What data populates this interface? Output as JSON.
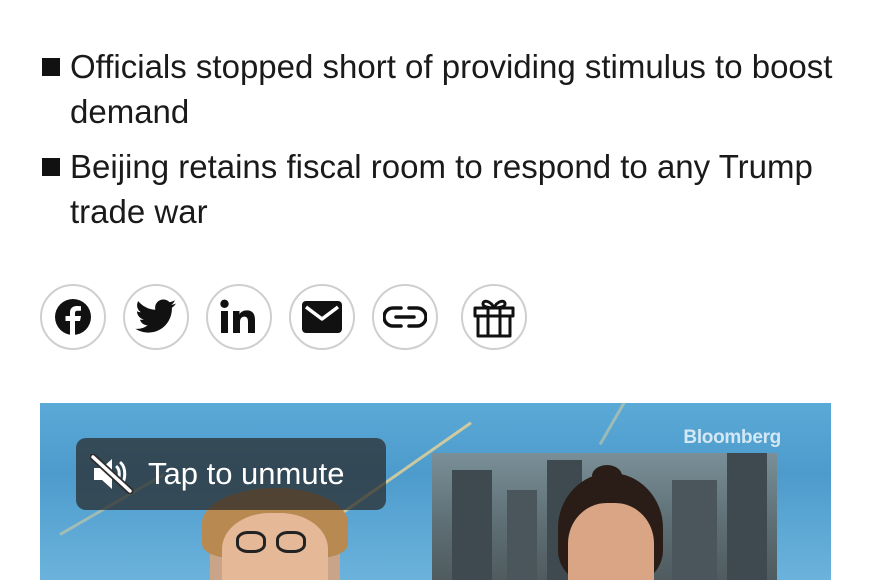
{
  "bullets": [
    {
      "text": "Officials stopped short of providing stimulus to boost demand"
    },
    {
      "text": "Beijing retains fiscal room to respond to any Trump trade war"
    }
  ],
  "share": {
    "buttons": [
      {
        "name": "facebook",
        "icon": "facebook-icon"
      },
      {
        "name": "twitter",
        "icon": "twitter-icon"
      },
      {
        "name": "linkedin",
        "icon": "linkedin-icon"
      },
      {
        "name": "email",
        "icon": "mail-icon"
      },
      {
        "name": "copy-link",
        "icon": "link-icon"
      },
      {
        "name": "gift",
        "icon": "gift-icon"
      }
    ]
  },
  "video": {
    "brand": "Bloomberg",
    "unmute_label": "Tap to unmute",
    "unmute_icon": "muted-speaker-icon"
  }
}
